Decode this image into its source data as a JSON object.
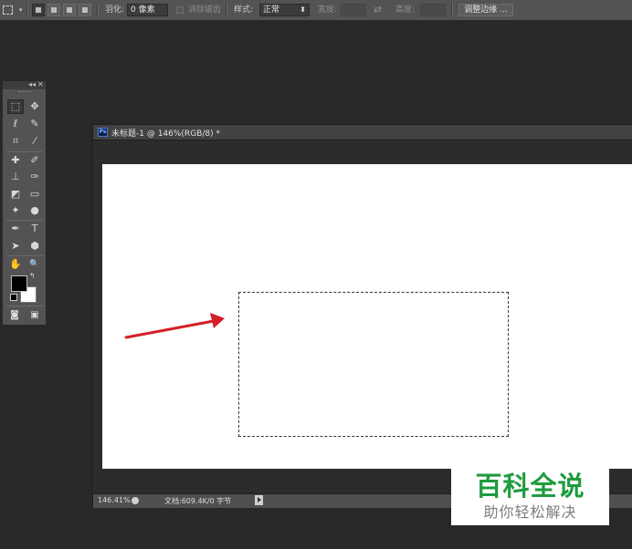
{
  "options_bar": {
    "tool_dropdown_arrow": "▾",
    "feather_label": "羽化:",
    "feather_value": "0 像素",
    "antialias_label": "消除锯齿",
    "style_label": "样式:",
    "style_value": "正常",
    "style_arrow": "⬍",
    "width_label": "宽度:",
    "swap_icon": "⇄",
    "height_label": "高度:",
    "refine_edge_label": "调整边缘 ..."
  },
  "toolbox": {
    "collapse_glyph": "◂◂",
    "close_glyph": "✕",
    "tools": [
      {
        "name": "rect-marquee-tool",
        "glyph": "⬚"
      },
      {
        "name": "move-tool",
        "glyph": "✥"
      },
      {
        "name": "lasso-tool",
        "glyph": "ℓ"
      },
      {
        "name": "quick-select-tool",
        "glyph": "✎"
      },
      {
        "name": "crop-tool",
        "glyph": "⌗"
      },
      {
        "name": "eyedropper-tool",
        "glyph": "⁄"
      },
      {
        "name": "healing-brush-tool",
        "glyph": "✚"
      },
      {
        "name": "brush-tool",
        "glyph": "✐"
      },
      {
        "name": "clone-stamp-tool",
        "glyph": "⊥"
      },
      {
        "name": "history-brush-tool",
        "glyph": "✑"
      },
      {
        "name": "eraser-tool",
        "glyph": "◩"
      },
      {
        "name": "gradient-tool",
        "glyph": "▭"
      },
      {
        "name": "blur-tool",
        "glyph": "✦"
      },
      {
        "name": "dodge-tool",
        "glyph": "●"
      },
      {
        "name": "pen-tool",
        "glyph": "✒"
      },
      {
        "name": "type-tool",
        "glyph": "T"
      },
      {
        "name": "path-select-tool",
        "glyph": "➤"
      },
      {
        "name": "shape-tool",
        "glyph": "⬢"
      },
      {
        "name": "hand-tool",
        "glyph": "✋"
      },
      {
        "name": "zoom-tool",
        "glyph": "🔍"
      }
    ],
    "swap_glyph": "↰",
    "quick-mask_glyph": "◙",
    "screen-mode_glyph": "▣",
    "colors": {
      "foreground": "#000000",
      "background": "#ffffff"
    }
  },
  "document": {
    "badge": "Ps",
    "title": "未标题-1 @ 146%(RGB/8) *",
    "zoom": "146.41%",
    "doc_info": "文档:609.4K/0 字节"
  },
  "watermark": {
    "main": "百科全说",
    "sub": "助你轻松解决"
  },
  "colors": {
    "accent_arrow": "#d42027",
    "watermark_green": "#1f9b3e"
  }
}
